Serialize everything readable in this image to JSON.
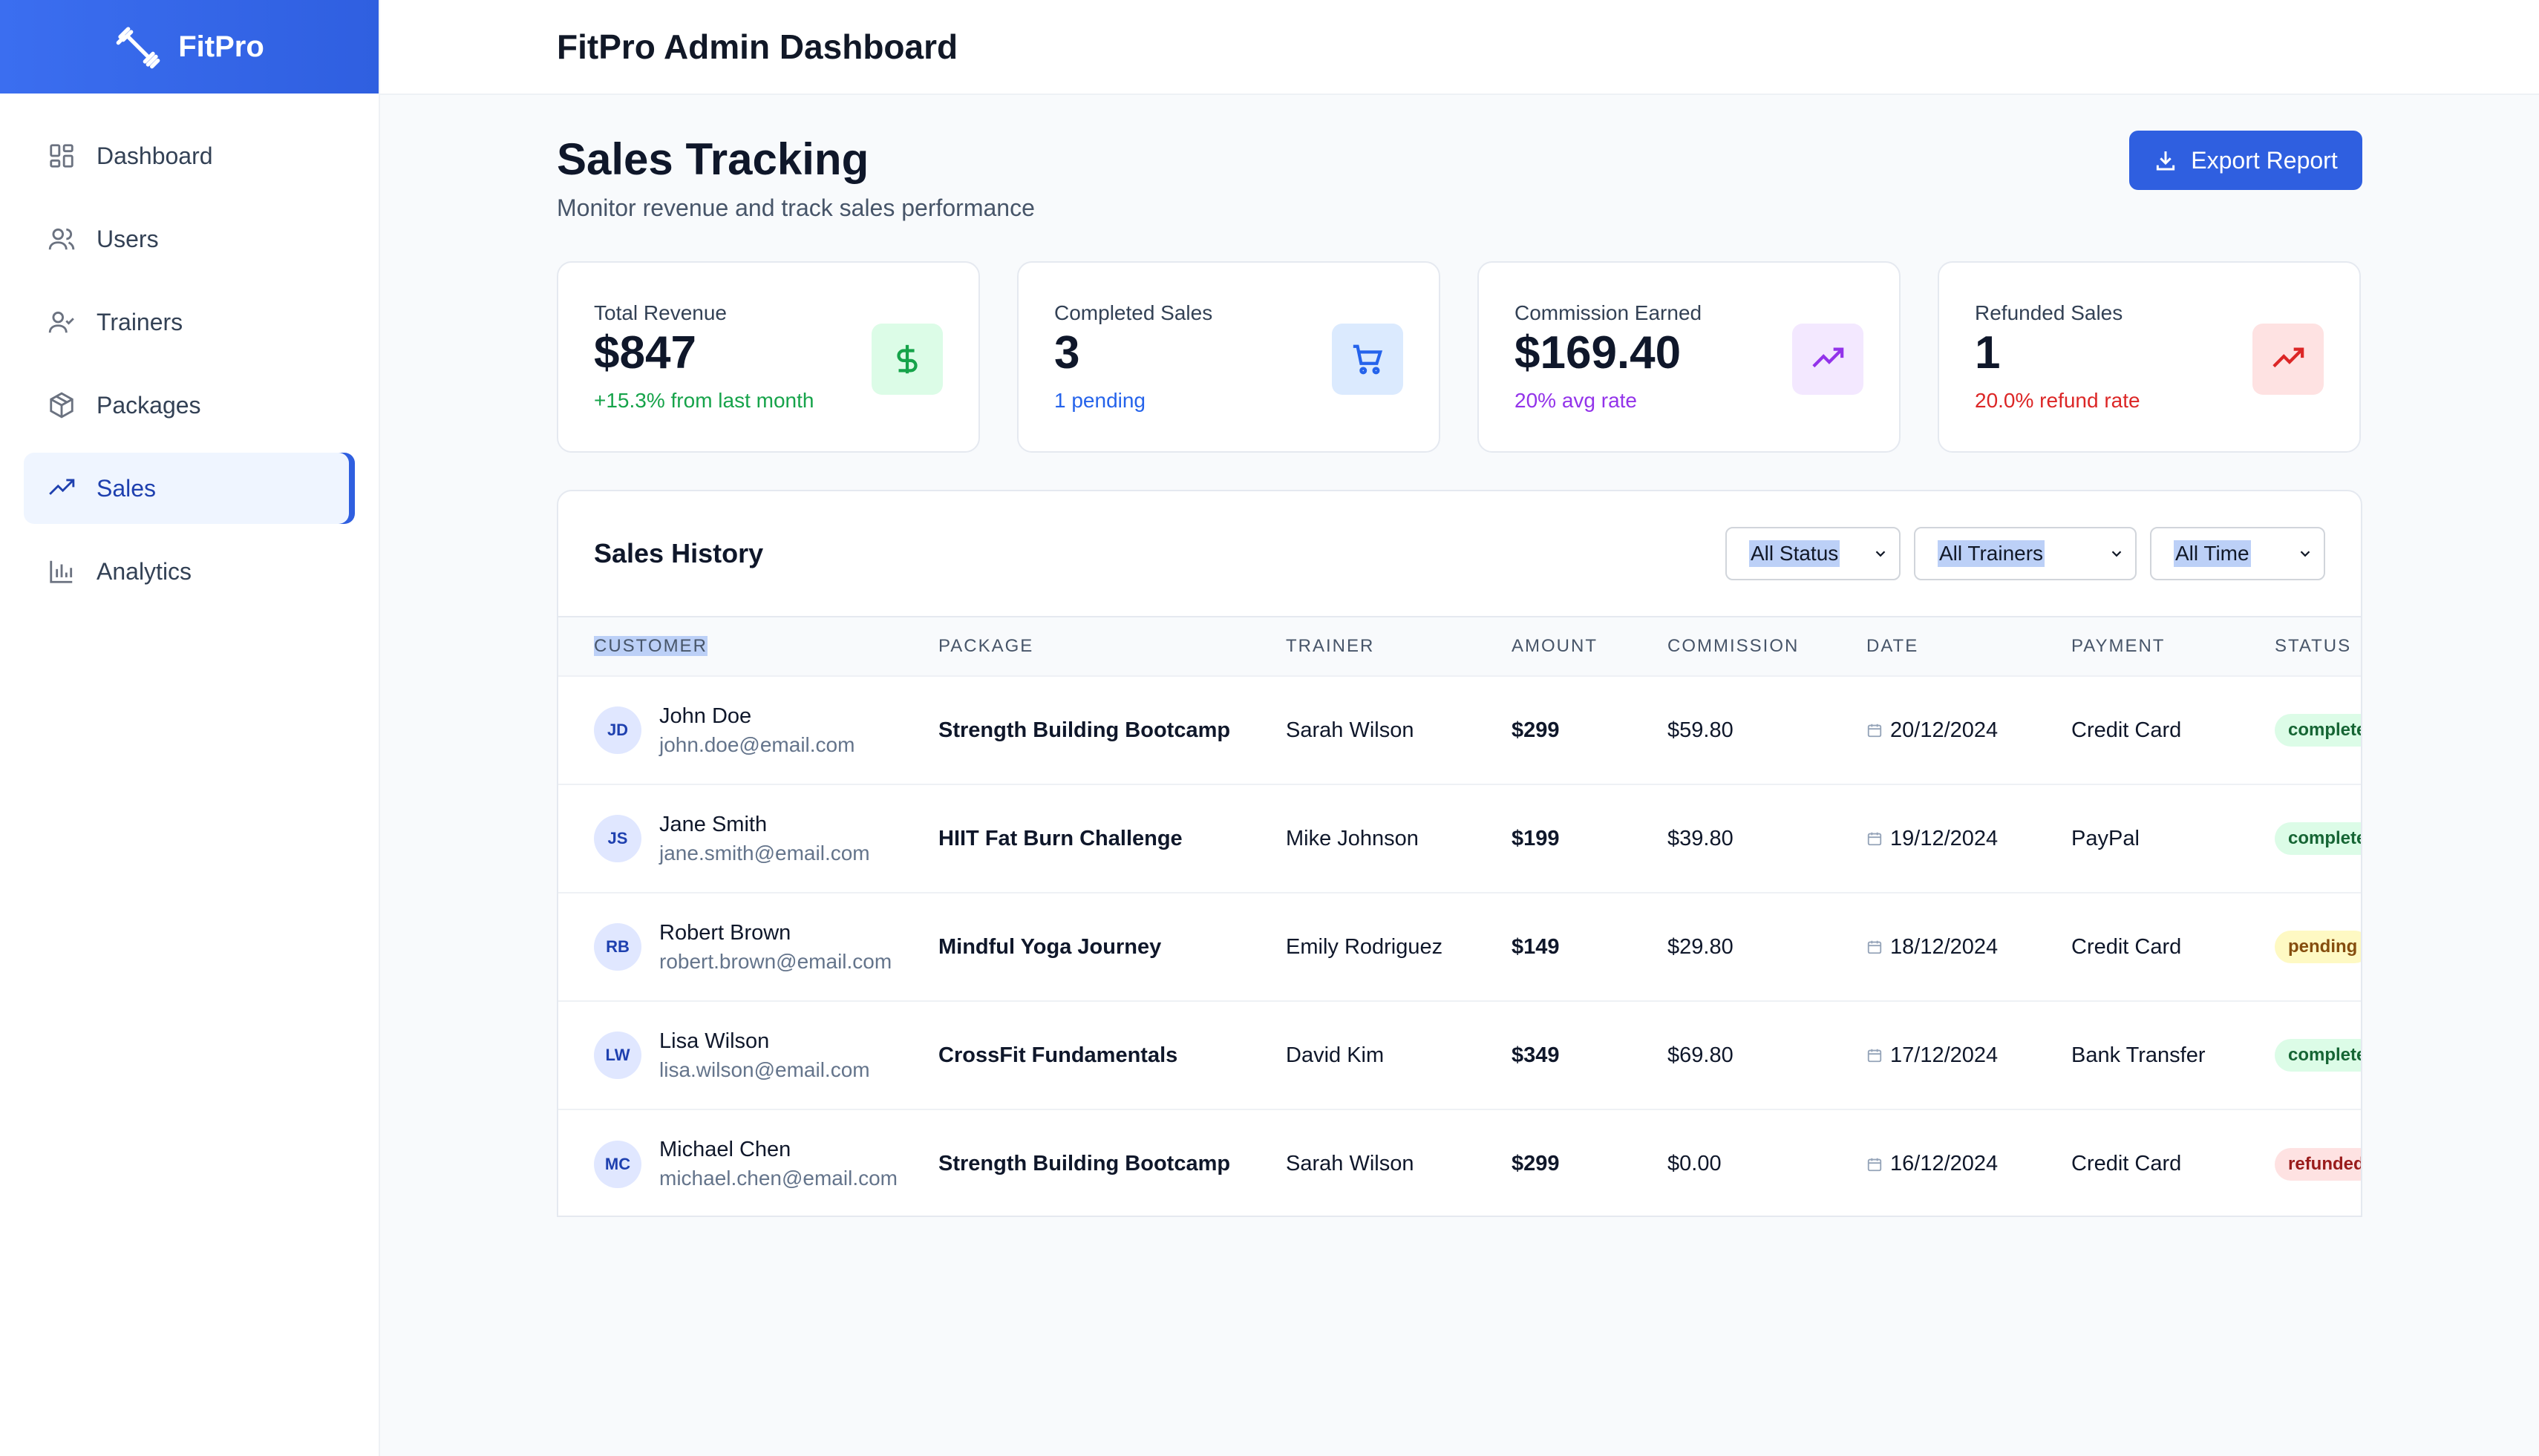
{
  "brand": {
    "name": "FitPro"
  },
  "header": {
    "title": "FitPro Admin Dashboard"
  },
  "sidebar": {
    "items": [
      {
        "label": "Dashboard",
        "icon": "grid-icon"
      },
      {
        "label": "Users",
        "icon": "users-icon"
      },
      {
        "label": "Trainers",
        "icon": "user-check-icon"
      },
      {
        "label": "Packages",
        "icon": "package-icon"
      },
      {
        "label": "Sales",
        "icon": "trending-up-icon",
        "active": true
      },
      {
        "label": "Analytics",
        "icon": "bar-chart-icon"
      }
    ]
  },
  "page": {
    "title": "Sales Tracking",
    "subtitle": "Monitor revenue and track sales performance",
    "export_label": "Export Report"
  },
  "cards": [
    {
      "label": "Total Revenue",
      "value": "$847",
      "note": "+15.3% from last month",
      "note_color": "#16a34a",
      "icon": "dollar-icon",
      "icon_bg": "#dcfce7",
      "icon_color": "#16a34a"
    },
    {
      "label": "Completed Sales",
      "value": "3",
      "note": "1 pending",
      "note_color": "#2563eb",
      "icon": "cart-icon",
      "icon_bg": "#dbeafe",
      "icon_color": "#2563eb"
    },
    {
      "label": "Commission Earned",
      "value": "$169.40",
      "note": "20% avg rate",
      "note_color": "#9333ea",
      "icon": "trending-up-icon",
      "icon_bg": "#f3e8ff",
      "icon_color": "#9333ea"
    },
    {
      "label": "Refunded Sales",
      "value": "1",
      "note": "20.0% refund rate",
      "note_color": "#dc2626",
      "icon": "trending-up-icon",
      "icon_bg": "#fee2e2",
      "icon_color": "#dc2626"
    }
  ],
  "sales_history": {
    "title": "Sales History",
    "filters": {
      "status": "All Status",
      "trainers": "All Trainers",
      "time": "All Time"
    },
    "columns": [
      "CUSTOMER",
      "PACKAGE",
      "TRAINER",
      "AMOUNT",
      "COMMISSION",
      "DATE",
      "PAYMENT",
      "STATUS"
    ],
    "rows": [
      {
        "initials": "JD",
        "name": "John Doe",
        "email": "john.doe@email.com",
        "package": "Strength Building Bootcamp",
        "trainer": "Sarah Wilson",
        "amount": "$299",
        "commission": "$59.80",
        "date": "20/12/2024",
        "payment": "Credit Card",
        "status": "completed",
        "status_bg": "#dcfce7",
        "status_color": "#166534"
      },
      {
        "initials": "JS",
        "name": "Jane Smith",
        "email": "jane.smith@email.com",
        "package": "HIIT Fat Burn Challenge",
        "trainer": "Mike Johnson",
        "amount": "$199",
        "commission": "$39.80",
        "date": "19/12/2024",
        "payment": "PayPal",
        "status": "completed",
        "status_bg": "#dcfce7",
        "status_color": "#166534"
      },
      {
        "initials": "RB",
        "name": "Robert Brown",
        "email": "robert.brown@email.com",
        "package": "Mindful Yoga Journey",
        "trainer": "Emily Rodriguez",
        "amount": "$149",
        "commission": "$29.80",
        "date": "18/12/2024",
        "payment": "Credit Card",
        "status": "pending",
        "status_bg": "#fef9c3",
        "status_color": "#854d0e"
      },
      {
        "initials": "LW",
        "name": "Lisa Wilson",
        "email": "lisa.wilson@email.com",
        "package": "CrossFit Fundamentals",
        "trainer": "David Kim",
        "amount": "$349",
        "commission": "$69.80",
        "date": "17/12/2024",
        "payment": "Bank Transfer",
        "status": "completed",
        "status_bg": "#dcfce7",
        "status_color": "#166534"
      },
      {
        "initials": "MC",
        "name": "Michael Chen",
        "email": "michael.chen@email.com",
        "package": "Strength Building Bootcamp",
        "trainer": "Sarah Wilson",
        "amount": "$299",
        "commission": "$0.00",
        "date": "16/12/2024",
        "payment": "Credit Card",
        "status": "refunded",
        "status_bg": "#fee2e2",
        "status_color": "#991b1b"
      }
    ]
  }
}
